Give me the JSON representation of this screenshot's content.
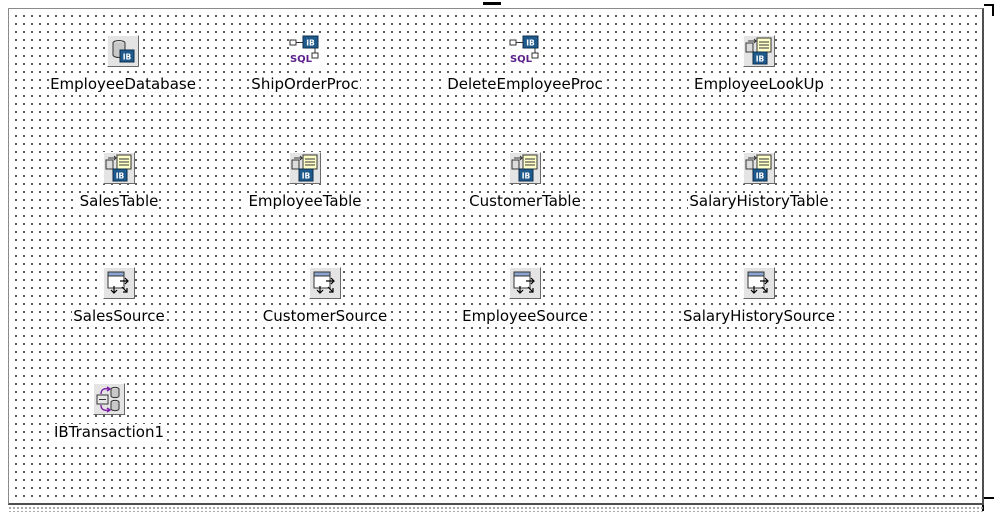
{
  "components": [
    {
      "label": "EmployeeDatabase",
      "icon": "ib-database-icon"
    },
    {
      "label": "ShipOrderProc",
      "icon": "ib-stored-proc-icon"
    },
    {
      "label": "DeleteEmployeeProc",
      "icon": "ib-stored-proc-icon"
    },
    {
      "label": "EmployeeLookUp",
      "icon": "ib-table-icon"
    },
    {
      "label": "SalesTable",
      "icon": "ib-table-icon"
    },
    {
      "label": "EmployeeTable",
      "icon": "ib-table-icon"
    },
    {
      "label": "CustomerTable",
      "icon": "ib-table-icon"
    },
    {
      "label": "SalaryHistoryTable",
      "icon": "ib-table-icon"
    },
    {
      "label": "SalesSource",
      "icon": "datasource-icon"
    },
    {
      "label": "CustomerSource",
      "icon": "datasource-icon"
    },
    {
      "label": "EmployeeSource",
      "icon": "datasource-icon"
    },
    {
      "label": "SalaryHistorySource",
      "icon": "datasource-icon"
    },
    {
      "label": "IBTransaction1",
      "icon": "ib-transaction-icon"
    }
  ],
  "colors": {
    "form_background": "#ffffff",
    "grid_dot": "#3c3c3c",
    "ib_badge": "#1f5a8c"
  }
}
